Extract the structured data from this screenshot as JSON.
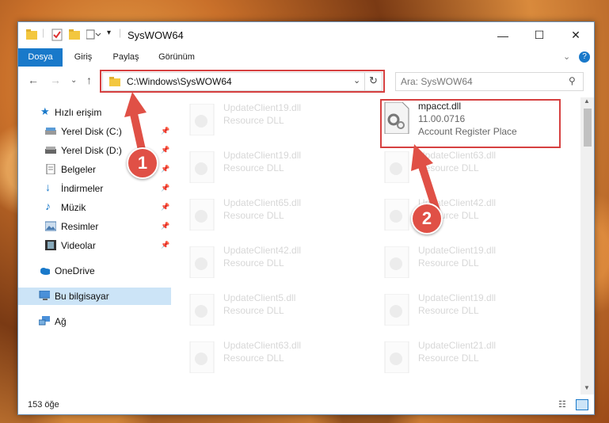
{
  "window": {
    "title": "SysWOW64"
  },
  "ribbon": {
    "tabs": [
      "Dosya",
      "Giriş",
      "Paylaş",
      "Görünüm"
    ]
  },
  "address": {
    "path": "C:\\Windows\\SysWOW64"
  },
  "search": {
    "placeholder": "Ara: SysWOW64"
  },
  "nav": {
    "quick_access": "Hızlı erişim",
    "items": [
      {
        "label": "Yerel Disk (C:)",
        "icon": "drive-icon",
        "pinned": true
      },
      {
        "label": "Yerel Disk (D:)",
        "icon": "drive-icon",
        "pinned": true
      },
      {
        "label": "Belgeler",
        "icon": "documents-icon",
        "pinned": true
      },
      {
        "label": "İndirmeler",
        "icon": "download-icon",
        "pinned": true
      },
      {
        "label": "Müzik",
        "icon": "music-icon",
        "pinned": true
      },
      {
        "label": "Resimler",
        "icon": "pictures-icon",
        "pinned": true
      },
      {
        "label": "Videolar",
        "icon": "video-icon",
        "pinned": true
      }
    ],
    "onedrive": "OneDrive",
    "this_pc": "Bu bilgisayar",
    "network": "Ağ"
  },
  "files": {
    "left": [
      {
        "name": "UpdateClient19.dll",
        "desc": "Resource DLL"
      },
      {
        "name": "UpdateClient19.dll",
        "desc": "Resource DLL"
      },
      {
        "name": "UpdateClient65.dll",
        "desc": "Resource DLL"
      },
      {
        "name": "UpdateClient42.dll",
        "desc": "Resource DLL"
      },
      {
        "name": "UpdateClient5.dll",
        "desc": "Resource DLL"
      },
      {
        "name": "UpdateClient63.dll",
        "desc": "Resource DLL"
      }
    ],
    "highlight": {
      "name": "mpacct.dll",
      "version": "11.00.0716",
      "desc": "Account Register Place"
    },
    "right": [
      {
        "name": "UpdateClient63.dll",
        "desc": "Resource DLL"
      },
      {
        "name": "UpdateClient42.dll",
        "desc": "Resource DLL"
      },
      {
        "name": "UpdateClient19.dll",
        "desc": "Resource DLL"
      },
      {
        "name": "UpdateClient19.dll",
        "desc": "Resource DLL"
      },
      {
        "name": "UpdateClient21.dll",
        "desc": "Resource DLL"
      }
    ]
  },
  "status": {
    "count": "153 öğe"
  },
  "callouts": [
    "1",
    "2"
  ],
  "colors": {
    "accent": "#1979ca",
    "annotation": "#d64040",
    "selection": "#cce4f7"
  }
}
